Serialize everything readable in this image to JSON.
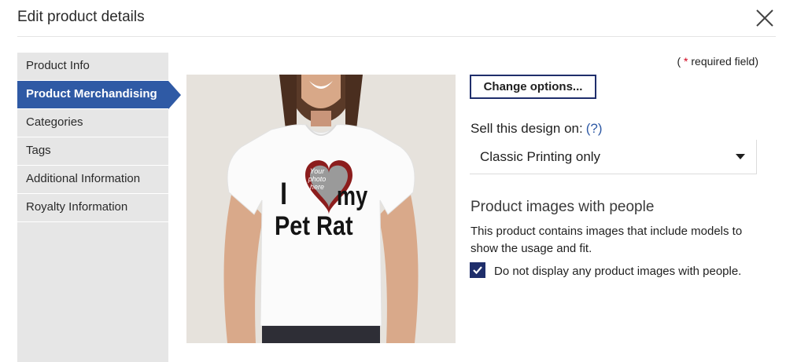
{
  "dialog": {
    "title": "Edit product details"
  },
  "sidebar": {
    "items": [
      {
        "label": "Product Info"
      },
      {
        "label": "Product Merchandising"
      },
      {
        "label": "Categories"
      },
      {
        "label": "Tags"
      },
      {
        "label": "Additional Information"
      },
      {
        "label": "Royalty Information"
      }
    ]
  },
  "required_note": {
    "open": "( ",
    "star": "*",
    "text": " required field)"
  },
  "product": {
    "shirt_text_i": "I",
    "shirt_text_my": "my",
    "shirt_text_pet_rat": "Pet Rat",
    "heart_placeholder": [
      "Your",
      "photo",
      "here"
    ]
  },
  "options": {
    "change_label": "Change options..."
  },
  "sell": {
    "label": "Sell this design on:",
    "help": "(?)",
    "selected": "Classic Printing only"
  },
  "people": {
    "title": "Product images with people",
    "description": "This product contains images that include models to show the usage and fit.",
    "checkbox_label": "Do not display any product images with people.",
    "checked": true
  },
  "colors": {
    "accent": "#2f5aa5",
    "navy": "#1f2e6b",
    "required_star": "#d0021b"
  }
}
